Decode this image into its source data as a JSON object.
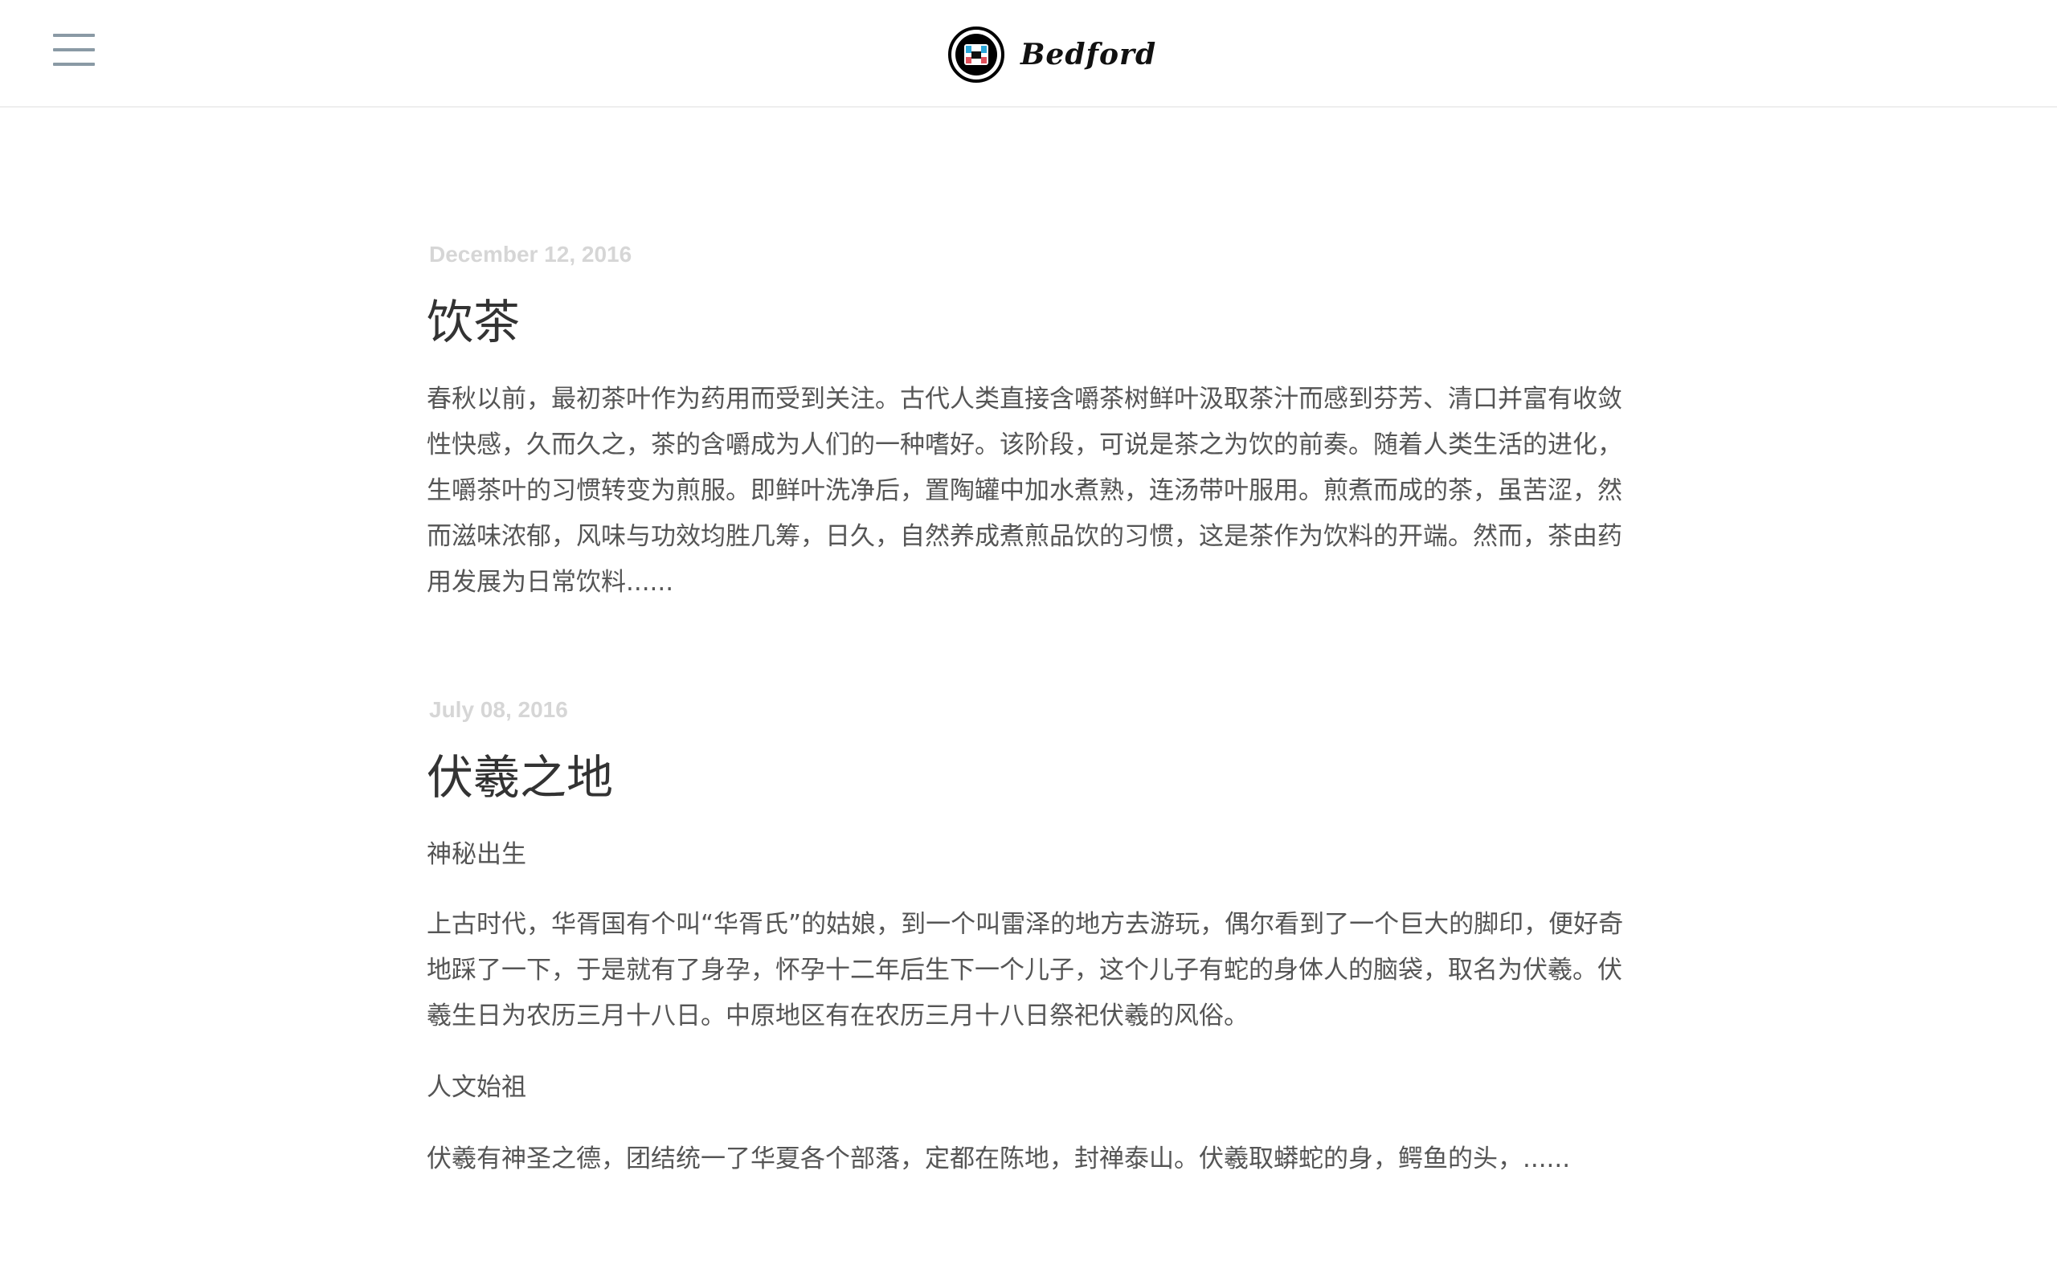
{
  "header": {
    "brand_name": "Bedford",
    "menu_icon": "hamburger-menu-icon",
    "logo_icon": "bedford-logo-icon"
  },
  "posts": [
    {
      "date": "December 12, 2016",
      "title": "饮茶",
      "body": "春秋以前，最初茶叶作为药用而受到关注。古代人类直接含嚼茶树鲜叶汲取茶汁而感到芬芳、清口并富有收敛性快感，久而久之，茶的含嚼成为人们的一种嗜好。该阶段，可说是茶之为饮的前奏。随着人类生活的进化，生嚼茶叶的习惯转变为煎服。即鲜叶洗净后，置陶罐中加水煮熟，连汤带叶服用。煎煮而成的茶，虽苦涩，然而滋味浓郁，风味与功效均胜几筹，日久，自然养成煮煎品饮的习惯，这是茶作为饮料的开端。然而，茶由药用发展为日常饮料......"
    },
    {
      "date": "July 08, 2016",
      "title": "伏羲之地",
      "section1_heading": "神秘出生",
      "section1_body": "上古时代，华胥国有个叫“华胥氏”的姑娘，到一个叫雷泽的地方去游玩，偶尔看到了一个巨大的脚印，便好奇地踩了一下，于是就有了身孕，怀孕十二年后生下一个儿子，这个儿子有蛇的身体人的脑袋，取名为伏羲。伏羲生日为农历三月十八日。中原地区有在农历三月十八日祭祀伏羲的风俗。",
      "section2_heading": "人文始祖",
      "section2_body": "伏羲有神圣之德，团结统一了华夏各个部落，定都在陈地，封禅泰山。伏羲取蟒蛇的身，鳄鱼的头，......"
    }
  ],
  "colors": {
    "menu_lines": "#8a9aa5",
    "date_text": "#d6d6d6",
    "title_text": "#333333",
    "body_text": "#555555",
    "divider": "#eeeeee"
  }
}
